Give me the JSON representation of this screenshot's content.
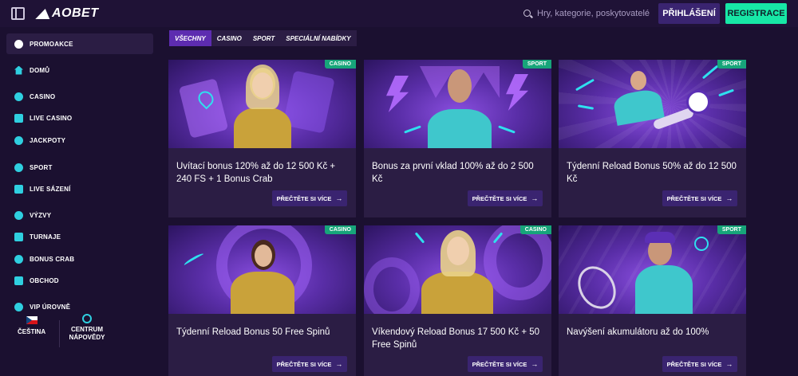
{
  "header": {
    "logo": "AOBET",
    "search_placeholder": "Hry, kategorie, poskytovatelé",
    "login_label": "PŘIHLÁŠENÍ",
    "register_label": "REGISTRACE"
  },
  "sidebar": {
    "items": [
      {
        "label": "PROMOAKCE",
        "icon": "gift-icon"
      },
      {
        "label": "DOMŮ",
        "icon": "home-icon"
      },
      {
        "label": "CASINO",
        "icon": "music-note-icon"
      },
      {
        "label": "LIVE CASINO",
        "icon": "cards-icon"
      },
      {
        "label": "JACKPOTY",
        "icon": "clover-icon"
      },
      {
        "label": "SPORT",
        "icon": "soccer-icon"
      },
      {
        "label": "LIVE SÁZENÍ",
        "icon": "live-icon"
      },
      {
        "label": "VÝZVY",
        "icon": "medal-icon"
      },
      {
        "label": "TURNAJE",
        "icon": "trophy-icon"
      },
      {
        "label": "BONUS CRAB",
        "icon": "crab-icon"
      },
      {
        "label": "OBCHOD",
        "icon": "shop-icon"
      },
      {
        "label": "VIP ÚROVNĚ",
        "icon": "diamond-icon"
      }
    ],
    "language": "ČEŠTINA",
    "help": "CENTRUM NÁPOVĚDY"
  },
  "tabs": [
    "VŠECHNY",
    "CASINO",
    "SPORT",
    "SPECIÁLNÍ NABÍDKY"
  ],
  "cards": [
    {
      "badge": "CASINO",
      "title": "Uvítací bonus 120% až do 12 500 Kč + 240 FS + 1 Bonus Crab",
      "button": "PŘEČTĚTE SI VÍCE"
    },
    {
      "badge": "SPORT",
      "title": "Bonus za první vklad 100% až do 2 500 Kč",
      "button": "PŘEČTĚTE SI VÍCE"
    },
    {
      "badge": "SPORT",
      "title": "Týdenní Reload Bonus 50% až do 12 500 Kč",
      "button": "PŘEČTĚTE SI VÍCE"
    },
    {
      "badge": "CASINO",
      "title": "Týdenní Reload Bonus 50 Free Spinů",
      "button": "PŘEČTĚTE SI VÍCE"
    },
    {
      "badge": "CASINO",
      "title": "Víkendový Reload Bonus 17 500 Kč + 50 Free Spinů",
      "button": "PŘEČTĚTE SI VÍCE"
    },
    {
      "badge": "SPORT",
      "title": "Navýšení akumulátoru až do 100%",
      "button": "PŘEČTĚTE SI VÍCE"
    }
  ],
  "colors": {
    "accent_green": "#17e7a6",
    "purple_button": "#3a2470",
    "tab_active": "#5d2cb0",
    "background": "#1b1030"
  }
}
